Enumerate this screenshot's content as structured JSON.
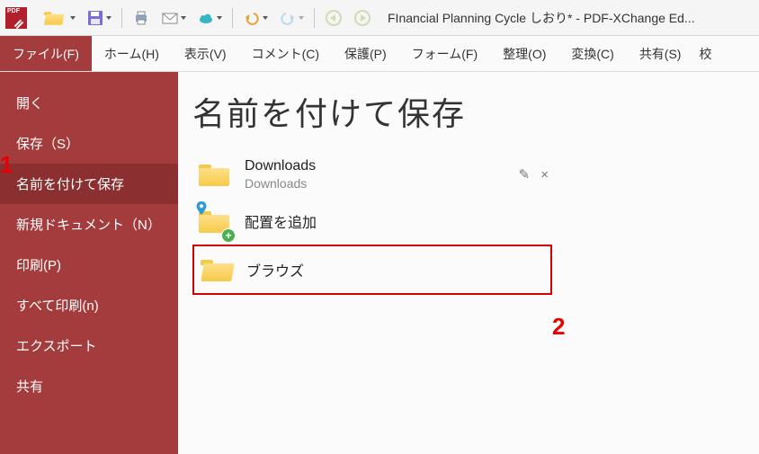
{
  "titlebar": {
    "title": "FInancial Planning Cycle しおり* - PDF-XChange Ed..."
  },
  "ribbon": {
    "tabs": [
      "ファイル(F)",
      "ホーム(H)",
      "表示(V)",
      "コメント(C)",
      "保護(P)",
      "フォーム(F)",
      "整理(O)",
      "変換(C)",
      "共有(S)"
    ],
    "overflow": "校"
  },
  "sidebar": {
    "items": [
      "開く",
      "保存（S）",
      "名前を付けて保存",
      "新規ドキュメント（N）",
      "印刷(P)",
      "すべて印刷(n)",
      "エクスポート",
      "共有"
    ],
    "selected_index": 2
  },
  "content": {
    "heading": "名前を付けて保存",
    "recent": {
      "name": "Downloads",
      "path": "Downloads",
      "edit_glyph": "✎",
      "close_glyph": "×"
    },
    "add_location": "配置を追加",
    "browse": "ブラウズ"
  },
  "annotations": {
    "one": "1",
    "two": "2"
  }
}
